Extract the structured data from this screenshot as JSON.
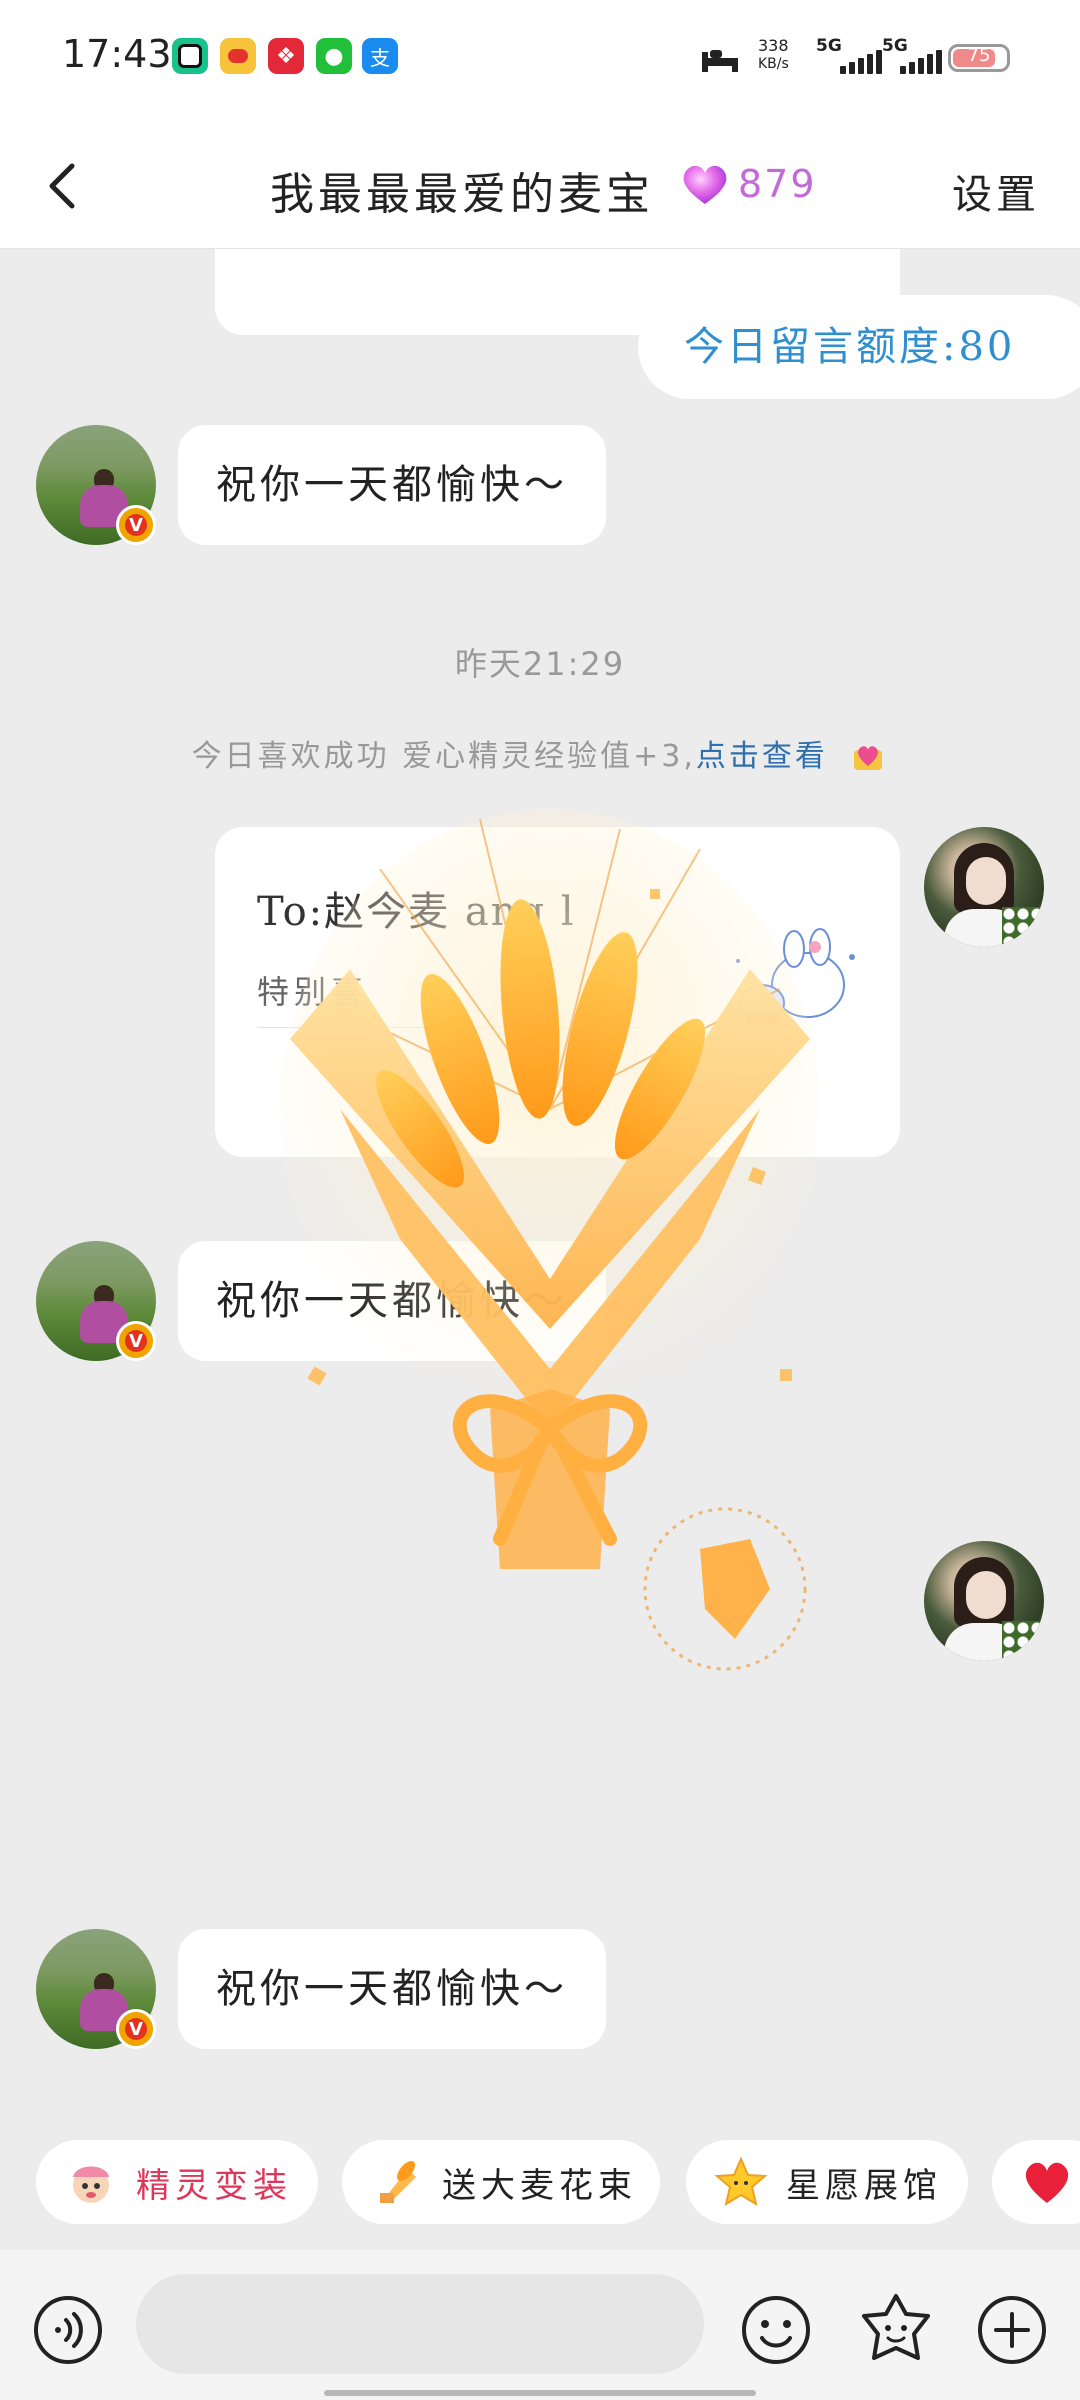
{
  "status_bar": {
    "time": "17:43",
    "net_speed_value": "338",
    "net_speed_unit": "KB/s",
    "sim1": "5G",
    "sim2": "5G",
    "battery": "75"
  },
  "header": {
    "title": "我最最最爱的麦宝",
    "intimacy_count": "879",
    "settings_label": "设置"
  },
  "chat": {
    "quota_label": "今日留言额度:80",
    "messages": [
      {
        "text": "祝你一天都愉快～"
      },
      {
        "text": "祝你一天都愉快～"
      },
      {
        "text": "祝你一天都愉快～"
      }
    ],
    "timestamp": "昨天21:29",
    "system_note": "今日喜欢成功 爱心精灵经验值+3,",
    "system_note_link": "点击查看",
    "letter_to": "To:赵今麦 ang l",
    "letter_sub": "特别喜"
  },
  "quick_actions": [
    {
      "label": "精灵变装",
      "color": "#e0365a"
    },
    {
      "label": "送大麦花束",
      "color": "#333333"
    },
    {
      "label": "星愿展馆",
      "color": "#333333"
    }
  ],
  "colors": {
    "accent_blue": "#2f8fd0",
    "intimacy_purple": "#c26bd8",
    "link_blue": "#2f6fae"
  }
}
